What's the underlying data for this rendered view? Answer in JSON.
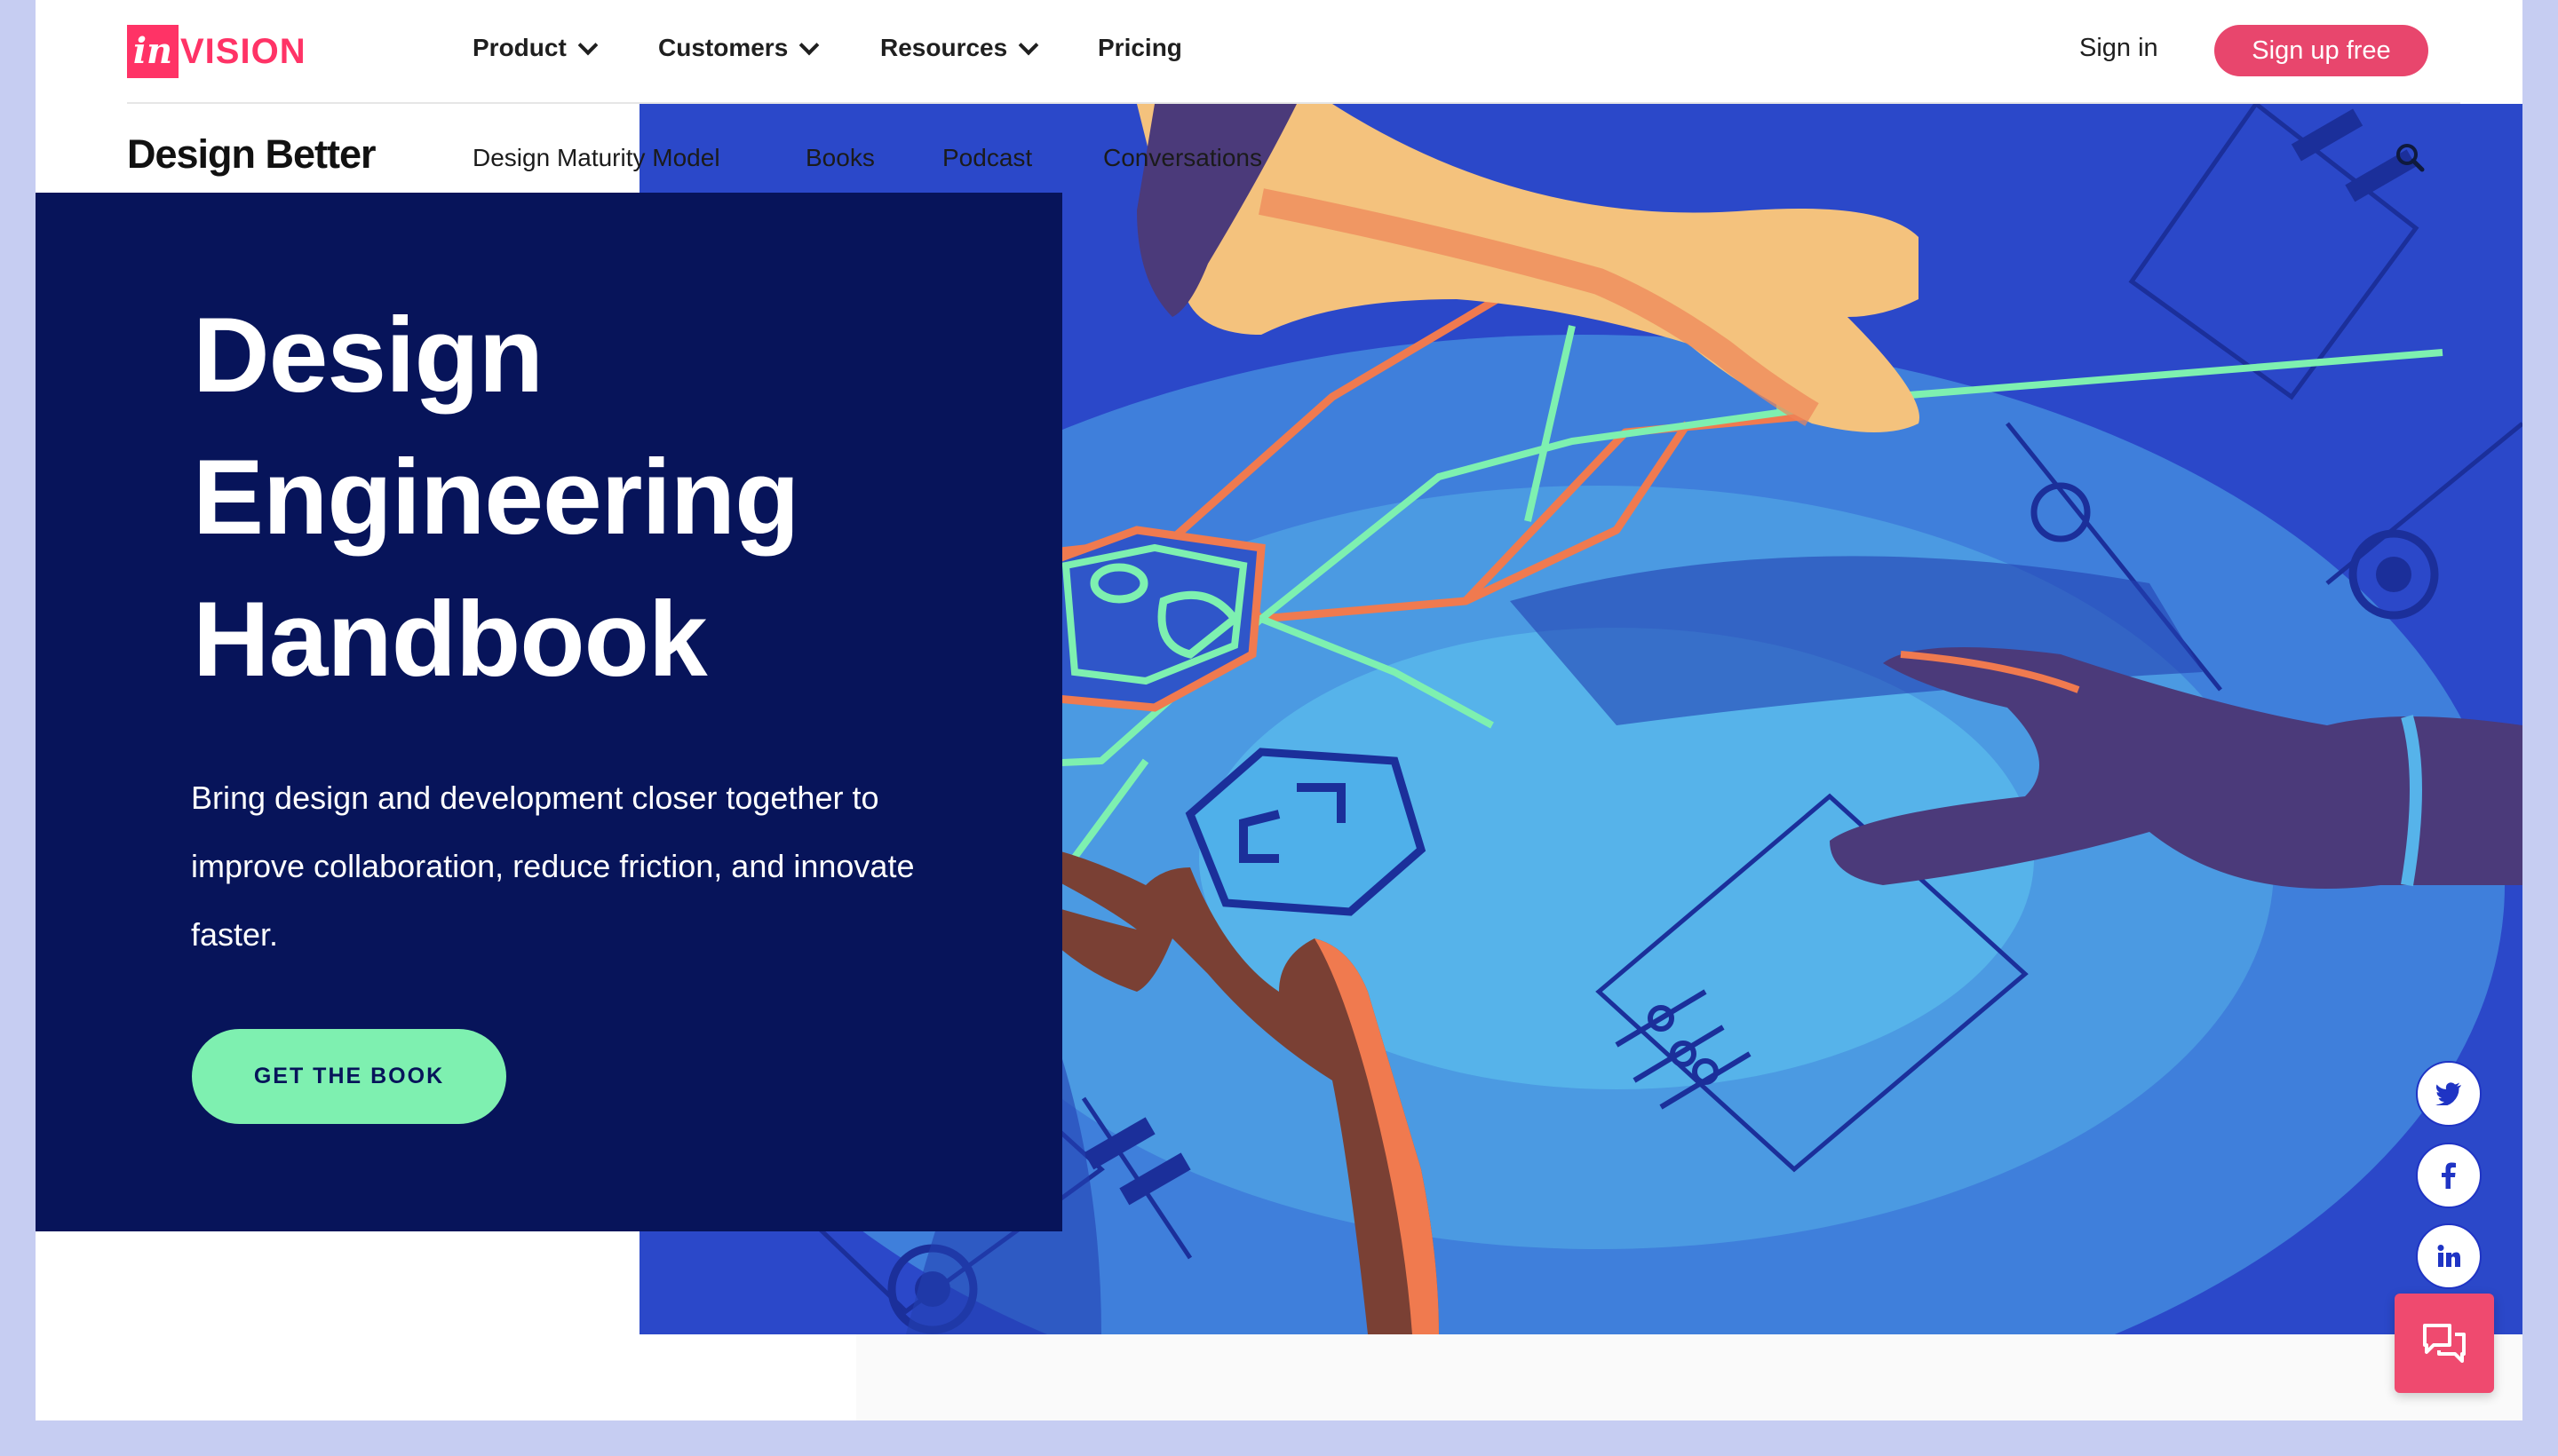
{
  "topnav": {
    "logo_mark": "in",
    "logo_text": "VISION",
    "items": [
      {
        "label": "Product",
        "has_dropdown": true
      },
      {
        "label": "Customers",
        "has_dropdown": true
      },
      {
        "label": "Resources",
        "has_dropdown": true
      },
      {
        "label": "Pricing",
        "has_dropdown": false
      }
    ],
    "signin_label": "Sign in",
    "signup_label": "Sign up free"
  },
  "subnav": {
    "brand": "Design Better",
    "items": [
      "Design Maturity Model",
      "Books",
      "Podcast",
      "Conversations"
    ]
  },
  "hero": {
    "title_lines": [
      "Design",
      "Engineering",
      "Handbook"
    ],
    "description": "Bring design and development closer together to improve collaboration, reduce friction, and innovate faster.",
    "cta_label": "GET THE BOOK"
  },
  "share": [
    {
      "network": "twitter",
      "icon": "twitter-icon"
    },
    {
      "network": "facebook",
      "icon": "facebook-icon"
    },
    {
      "network": "linkedin",
      "icon": "linkedin-icon"
    }
  ],
  "chat": {
    "icon": "chat-icon"
  },
  "colors": {
    "brand_pink": "#ff3366",
    "signup_bg": "#e8466d",
    "panel_navy": "#07145a",
    "cta_mint": "#7ef0b0",
    "art_blue": "#2f4fd0",
    "art_light_blue": "#4fa9e6",
    "page_border": "#c6cdf2"
  }
}
